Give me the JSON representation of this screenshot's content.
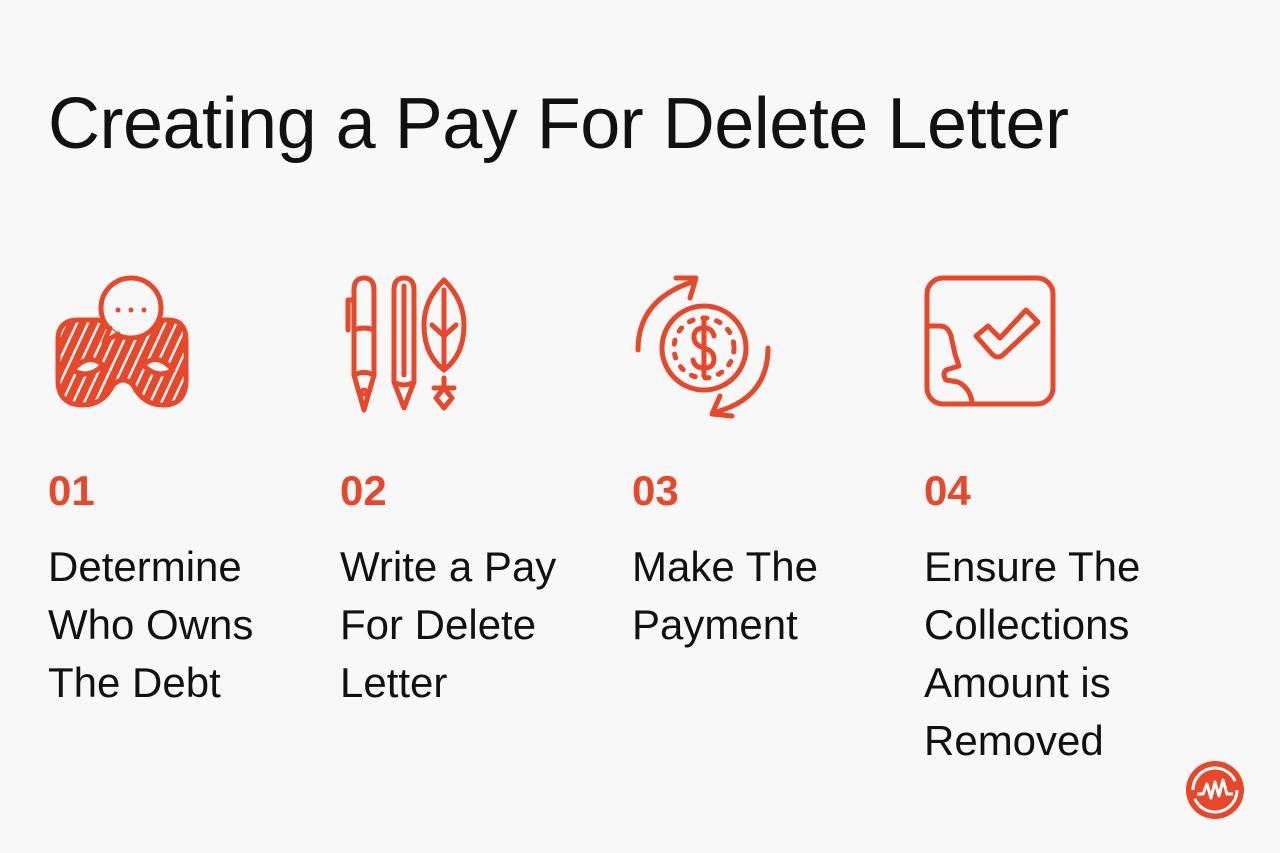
{
  "title": "Creating a Pay For Delete Letter",
  "accent_color": "#e8472a",
  "steps": [
    {
      "number": "01",
      "icon": "masks-speech-bubble-icon",
      "label": "Determine Who Owns The Debt",
      "lines": [
        "Determine",
        "Who Owns",
        "The Debt"
      ]
    },
    {
      "number": "02",
      "icon": "pens-pencil-quill-icon",
      "label": "Write a Pay For Delete Letter",
      "lines": [
        "Write a Pay",
        "For Delete",
        "Letter"
      ]
    },
    {
      "number": "03",
      "icon": "dollar-coin-cycle-icon",
      "label": "Make The Payment",
      "lines": [
        "Make The",
        "Payment"
      ]
    },
    {
      "number": "04",
      "icon": "checkmark-approval-icon",
      "label": "Ensure The Collections Amount is Removed",
      "lines": [
        "Ensure The",
        "Collections",
        "Amount is",
        "Removed"
      ]
    }
  ],
  "logo": "brand-logo-wave-icon"
}
